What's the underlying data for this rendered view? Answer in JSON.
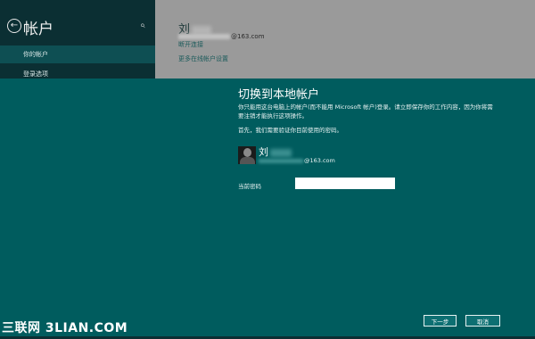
{
  "left_pane": {
    "title": "帐户",
    "nav_items": [
      {
        "label": "你的帐户",
        "selected": true
      },
      {
        "label": "登录选项",
        "selected": false
      }
    ]
  },
  "top_account": {
    "name_visible": "刘",
    "email_suffix": "@163.com",
    "links": [
      "断开连接",
      "更多在线帐户设置"
    ]
  },
  "dialog": {
    "title": "切换到本地帐户",
    "description": "你只能用这台电脑上的帐户(而不能用 Microsoft 帐户)登录。请立即保存你的工作内容，因为你将需要注销才能执行这项操作。",
    "verify_text": "首先，我们需要验证你目前使用的密码。",
    "user_name_visible": "刘",
    "user_email_suffix": "@163.com",
    "password_label": "当前密码",
    "password_value": "",
    "next_button": "下一步",
    "cancel_button": "取消"
  },
  "watermark": "三联网 3LIAN.COM",
  "colors": {
    "modal_bg": "#005c5e",
    "left_pane_bg": "#0b2f33",
    "right_pane_bg": "#9a9a9a",
    "nav_selected_bg": "#0e4f53"
  }
}
